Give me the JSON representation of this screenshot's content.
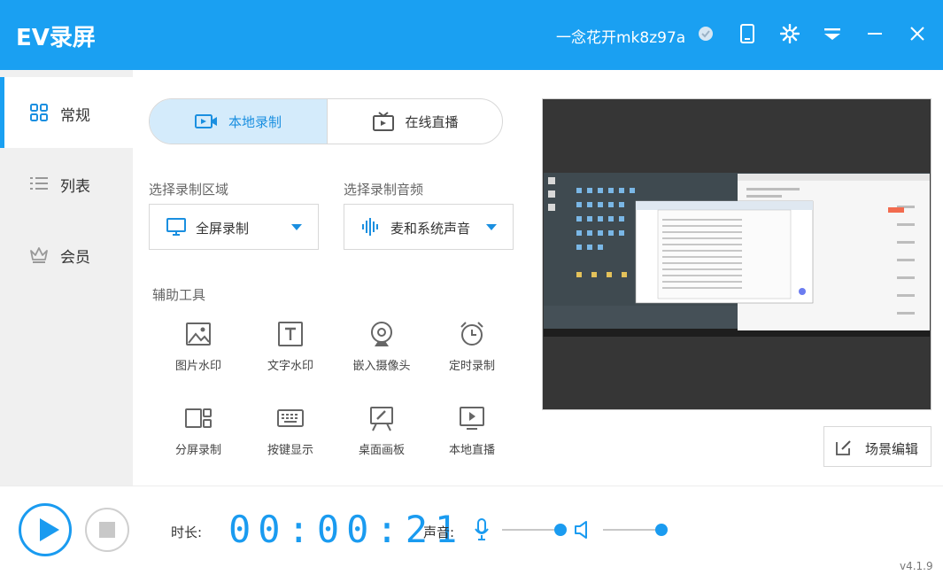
{
  "app": {
    "title": "EV录屏",
    "version": "v4.1.9"
  },
  "header": {
    "username": "一念花开mk8z97a"
  },
  "sidebar": {
    "items": [
      {
        "label": "常规",
        "active": true
      },
      {
        "label": "列表",
        "active": false
      },
      {
        "label": "会员",
        "active": false
      }
    ]
  },
  "modes": {
    "local": "本地录制",
    "live": "在线直播"
  },
  "region": {
    "label": "选择录制区域",
    "value": "全屏录制"
  },
  "audio": {
    "label": "选择录制音频",
    "value": "麦和系统声音"
  },
  "tools": {
    "label": "辅助工具",
    "items": [
      "图片水印",
      "文字水印",
      "嵌入摄像头",
      "定时录制",
      "分屏录制",
      "按键显示",
      "桌面画板",
      "本地直播"
    ]
  },
  "preview": {
    "scene_button": "场景编辑"
  },
  "controls": {
    "duration_label": "时长:",
    "timer": "00:00:21",
    "sound_label": "声音:",
    "mic_volume": 1.0,
    "speaker_volume": 1.0
  },
  "colors": {
    "accent": "#1aa0f2",
    "tab_active_bg": "#d4ebfb",
    "sidebar_bg": "#f0f0f0"
  }
}
